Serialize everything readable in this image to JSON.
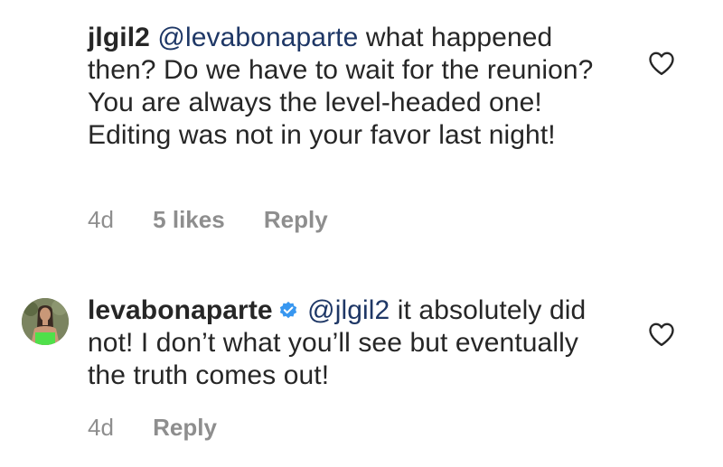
{
  "comments": [
    {
      "username": "jlgil2",
      "mention": "@levabonaparte",
      "text": "what happened then?  Do we have to wait for the reunion?  You are always the level-headed one!  Editing was not in your favor last night!",
      "time": "4d",
      "likes": "5 likes",
      "reply": "Reply",
      "liked": false
    },
    {
      "username": "levabonaparte",
      "verified": true,
      "mention": "@jlgil2",
      "text": "it absolutely did not! I don’t what you’ll see but eventually the truth comes out!",
      "time": "4d",
      "reply": "Reply",
      "liked": false
    }
  ],
  "colors": {
    "text": "#262626",
    "mention": "#1e3766",
    "meta": "#8e8e8e",
    "verified": "#3897f0"
  },
  "icons": {
    "like": "heart-outline-icon",
    "verified": "verified-badge-icon"
  }
}
